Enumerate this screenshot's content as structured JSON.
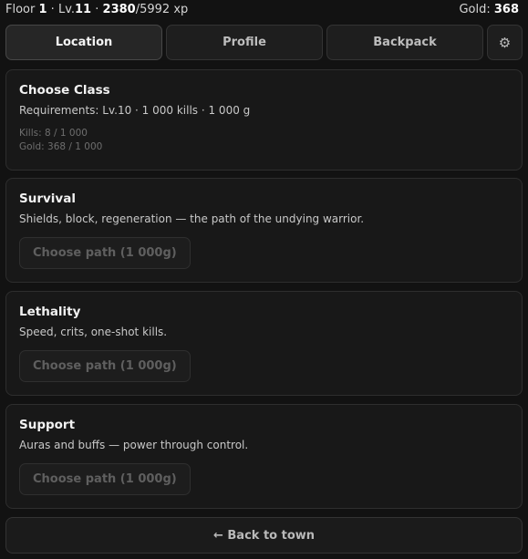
{
  "status": {
    "floor_label": "Floor",
    "floor": "1",
    "sep1": "·",
    "level_label": "Lv.",
    "level": "11",
    "sep2": "·",
    "xp_current": "2380",
    "xp_rest": "/5992 xp",
    "gold_label": "Gold:",
    "gold": "368"
  },
  "nav": {
    "tabs": [
      {
        "label": "Location",
        "active": true
      },
      {
        "label": "Profile",
        "active": false
      },
      {
        "label": "Backpack",
        "active": false
      }
    ],
    "settings_glyph": "⚙"
  },
  "class_card": {
    "title": "Choose Class",
    "requirements": "Requirements: Lv.10 · 1 000 kills · 1 000 g",
    "kills_progress": "Kills: 8 / 1 000",
    "gold_progress": "Gold: 368 / 1 000"
  },
  "paths": [
    {
      "title": "Survival",
      "description": "Shields, block, regeneration — the path of the undying warrior.",
      "button": "Choose path (1 000g)"
    },
    {
      "title": "Lethality",
      "description": "Speed, crits, one-shot kills.",
      "button": "Choose path (1 000g)"
    },
    {
      "title": "Support",
      "description": "Auras and buffs — power through control.",
      "button": "Choose path (1 000g)"
    }
  ],
  "back_button": "← Back to town"
}
